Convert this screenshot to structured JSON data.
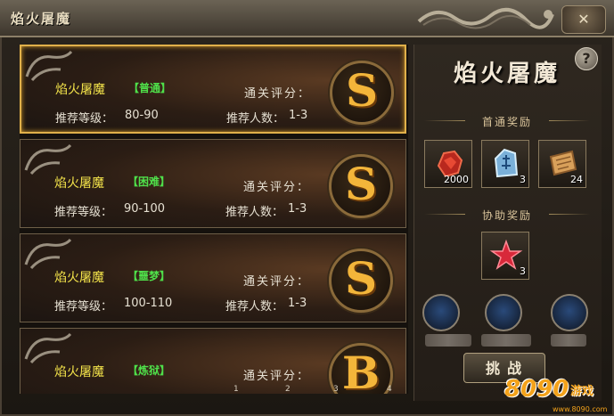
{
  "window": {
    "title": "焰火屠魔",
    "close_label": "✕"
  },
  "dungeons": [
    {
      "name": "焰火屠魔",
      "difficulty": "【普通】",
      "level_label": "推荐等级：",
      "level": "80-90",
      "score_label": "通关评分：",
      "players_label": "推荐人数：",
      "players": "1-3",
      "grade": "S",
      "selected": true
    },
    {
      "name": "焰火屠魔",
      "difficulty": "【困难】",
      "level_label": "推荐等级：",
      "level": "90-100",
      "score_label": "通关评分：",
      "players_label": "推荐人数：",
      "players": "1-3",
      "grade": "S",
      "selected": false
    },
    {
      "name": "焰火屠魔",
      "difficulty": "【噩梦】",
      "level_label": "推荐等级：",
      "level": "100-110",
      "score_label": "通关评分：",
      "players_label": "推荐人数：",
      "players": "1-3",
      "grade": "S",
      "selected": false
    },
    {
      "name": "焰火屠魔",
      "difficulty": "【炼狱】",
      "score_label": "通关评分：",
      "grade": "B",
      "selected": false
    }
  ],
  "pager": [
    "1",
    "2",
    "3",
    "4"
  ],
  "detail": {
    "help_label": "?",
    "boss_title": "焰火屠魔",
    "first_clear_heading": "首通奖励",
    "first_clear_rewards": [
      {
        "icon": "red-ore-icon",
        "count": "2000"
      },
      {
        "icon": "blue-rune-stone-icon",
        "count": "3"
      },
      {
        "icon": "scroll-icon",
        "count": "24"
      }
    ],
    "assist_heading": "协助奖励",
    "assist_rewards": [
      {
        "icon": "red-star-icon",
        "count": "3"
      }
    ],
    "challenge_label": "挑战"
  },
  "watermark": {
    "text": "8090",
    "sub": "游戏",
    "url": "www.8090.com"
  },
  "colors": {
    "difficulty_green": "#4fe04a",
    "name_yellow": "#f2e24a",
    "grade_gold": "#f3b53a",
    "selected_border": "#e0b04a"
  }
}
